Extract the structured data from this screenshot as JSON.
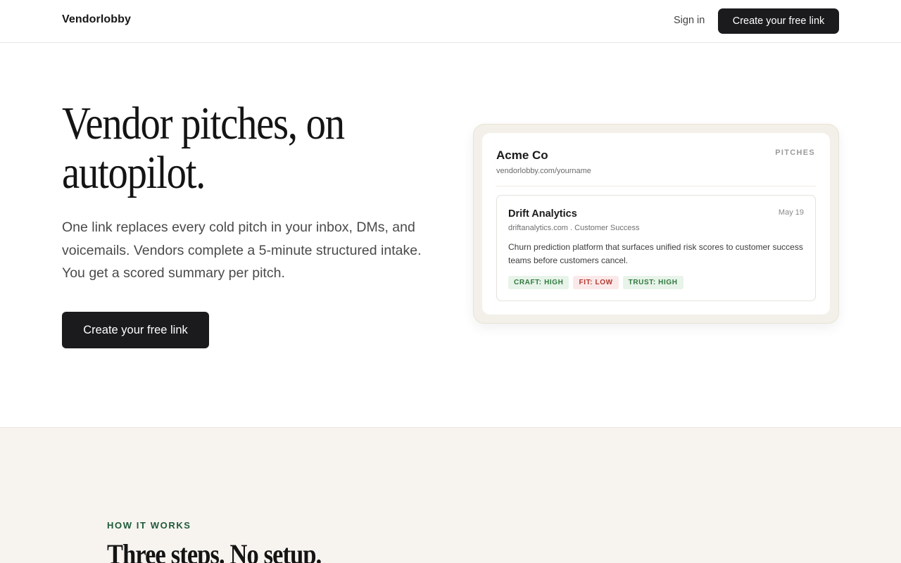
{
  "nav": {
    "brand": "Vendorlobby",
    "signin_label": "Sign in",
    "cta_label": "Create your free link"
  },
  "hero": {
    "title": "Vendor pitches, on autopilot.",
    "subtitle": "One link replaces every cold pitch in your inbox, DMs, and voicemails. Vendors complete a 5-minute structured intake. You get a scored summary per pitch.",
    "cta_label": "Create your free link"
  },
  "mockup": {
    "org_name": "Acme Co",
    "org_url": "vendorlobby.com/yourname",
    "section_label": "PITCHES",
    "pitch": {
      "name": "Drift Analytics",
      "date": "May 19",
      "meta": "driftanalytics.com . Customer Success",
      "description": "Churn prediction platform that surfaces unified risk scores to customer success teams before customers cancel.",
      "badges": [
        {
          "label": "CRAFT: HIGH",
          "tone": "green"
        },
        {
          "label": "FIT: LOW",
          "tone": "red"
        },
        {
          "label": "TRUST: HIGH",
          "tone": "green"
        }
      ]
    }
  },
  "how": {
    "eyebrow": "HOW IT WORKS",
    "title": "Three steps. No setup."
  },
  "colors": {
    "accent_dark": "#1b1b1d",
    "eyebrow_green": "#1e5a3a",
    "badge_green": "#2f7a3f",
    "badge_red": "#b3372f",
    "section_bg": "#f7f4ef"
  }
}
